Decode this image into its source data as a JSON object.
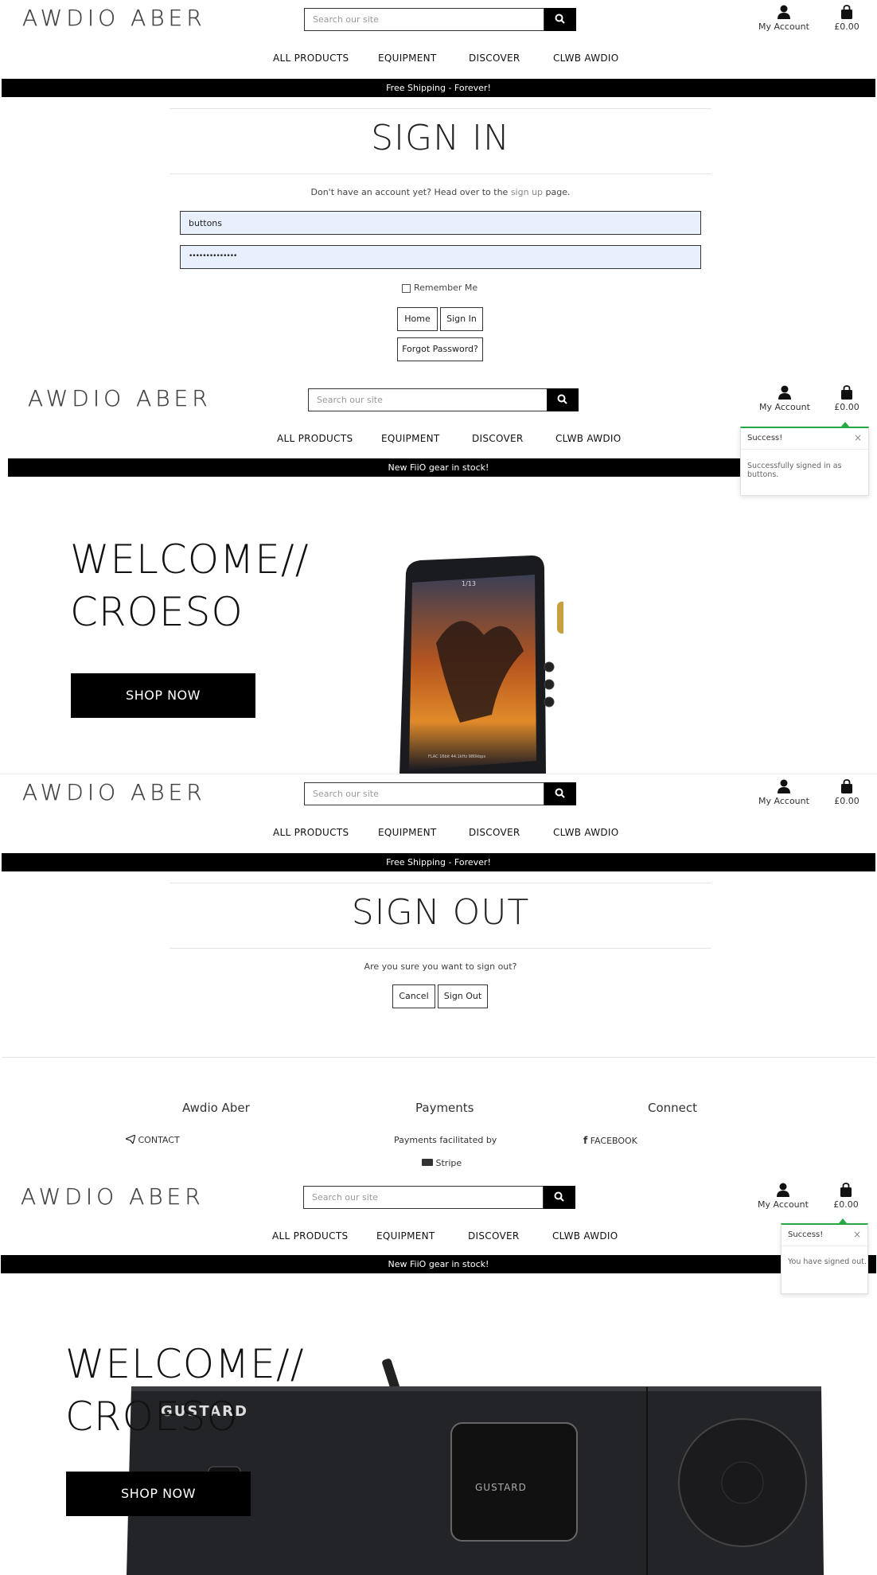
{
  "header": {
    "logo": "AWDIO ABER",
    "search_placeholder": "Search our site",
    "account_label": "My Account",
    "cart_total": "£0.00",
    "nav": [
      "ALL PRODUCTS",
      "EQUIPMENT",
      "DISCOVER",
      "CLWB AWDIO"
    ]
  },
  "banners": {
    "shipping": "Free Shipping - Forever!",
    "new_stock": "New FiiO gear in stock!"
  },
  "signin": {
    "title": "SIGN IN",
    "prompt_before": "Don't have an account yet? Head over to the ",
    "prompt_link": "sign up",
    "prompt_after": " page.",
    "username_value": "buttons",
    "password_value": "••••••••••••••",
    "remember_label": "Remember Me",
    "home_button": "Home",
    "signin_button": "Sign In",
    "forgot_button": "Forgot Password?"
  },
  "toast_signin": {
    "title": "Success!",
    "close": "×",
    "message": "Successfully signed in as buttons."
  },
  "hero": {
    "line1": "WELCOME//",
    "line2": "CROESO",
    "cta": "SHOP NOW",
    "player_screen_text": "1/13",
    "player_footer": "FLAC 16bit 44.1kHz 980kbps",
    "amp_brand": "GUSTARD"
  },
  "signout": {
    "title": "SIGN OUT",
    "prompt": "Are you sure you want to sign out?",
    "cancel_button": "Cancel",
    "signout_button": "Sign Out"
  },
  "footer": {
    "col1_title": "Awdio Aber",
    "col1_link": "CONTACT",
    "col2_title": "Payments",
    "col2_text": "Payments facilitated by",
    "col2_brand": "Stripe",
    "col3_title": "Connect",
    "col3_link": "FACEBOOK"
  },
  "toast_signout": {
    "title": "Success!",
    "close": "×",
    "message": "You have signed out."
  },
  "colors": {
    "success_accent": "#28a745",
    "banner_bg": "#000000",
    "autofill_bg": "#e8f0fe"
  }
}
